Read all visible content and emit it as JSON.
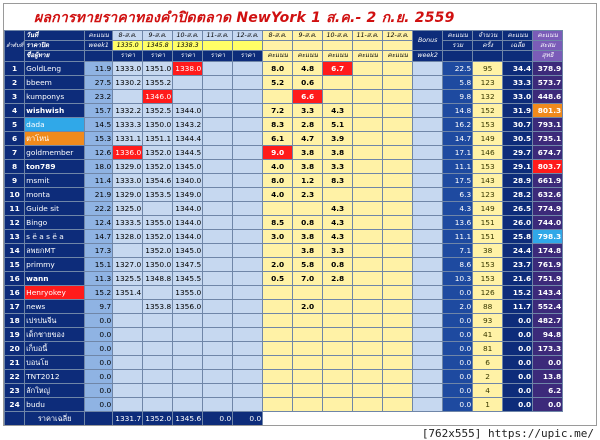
{
  "title": "ผลการทายราคาทองคำปิดตลาด NewYork 1 ส.ค.- 2 ก.ย. 2559",
  "watermark": "[762x555] https://upic.me/",
  "headers": {
    "corner_top": "วันที่",
    "corner_mid": "ราคาปิด",
    "corner_bottom": "ชื่อผู้ทาย",
    "rank_label": "ลำดับที่",
    "score_w1": "คะแนน",
    "week1": "week1",
    "date_cols": [
      "8-ส.ค.",
      "9-ส.ค.",
      "10-ส.ค.",
      "11-ส.ค.",
      "12-ส.ค."
    ],
    "close_prices": [
      "1335.0",
      "1345.8",
      "1338.3",
      "",
      ""
    ],
    "price_label": "ราคา",
    "score_cols": [
      "8-ส.ค.",
      "9-ส.ค.",
      "10-ส.ค.",
      "11-ส.ค.",
      "12-ส.ค."
    ],
    "score_label": "คะแนน",
    "bonus": "Bonus",
    "week2": "week2",
    "total_score": "คะแนน",
    "total_sub": "รวม",
    "count_label": "จำนวน",
    "count_sub": "ครั้ง",
    "avg_label": "คะแนน",
    "avg_sub": "เฉลี่ย",
    "cum_label": "คะแนน",
    "cum_sub": "สะสม",
    "cum_sub2": "สุทธิ"
  },
  "rows": [
    {
      "no": "1",
      "name": "GoldLeng",
      "w1": "11.9",
      "p": [
        "1333.0",
        "1351.0",
        "1338.0",
        "",
        ""
      ],
      "s": [
        "8.0",
        "4.8",
        "6.7",
        "",
        ""
      ],
      "bonus": "",
      "total": "22.5",
      "count": "95",
      "avg": "34.4",
      "cum": "378.9"
    },
    {
      "no": "2",
      "name": "bbeem",
      "w1": "27.5",
      "p": [
        "1330.2",
        "1355.2",
        "",
        "",
        ""
      ],
      "s": [
        "5.2",
        "0.6",
        "",
        "",
        ""
      ],
      "bonus": "",
      "total": "5.8",
      "count": "123",
      "avg": "33.3",
      "cum": "573.7"
    },
    {
      "no": "3",
      "name": "kumponys",
      "w1": "23.2",
      "p": [
        "",
        "1346.0",
        "",
        "",
        ""
      ],
      "s": [
        "",
        "6.6",
        "",
        "",
        ""
      ],
      "bonus": "",
      "total": "9.8",
      "count": "132",
      "avg": "33.0",
      "cum": "448.6"
    },
    {
      "no": "4",
      "name": "wishwish",
      "w1": "15.7",
      "p": [
        "1332.2",
        "1352.5",
        "1344.0",
        "",
        ""
      ],
      "s": [
        "7.2",
        "3.3",
        "4.3",
        "",
        ""
      ],
      "bonus": "",
      "total": "14.8",
      "count": "152",
      "avg": "31.9",
      "cum": "801.3"
    },
    {
      "no": "5",
      "name": "dada",
      "w1": "14.5",
      "p": [
        "1333.3",
        "1350.0",
        "1343.2",
        "",
        ""
      ],
      "s": [
        "8.3",
        "2.8",
        "5.1",
        "",
        ""
      ],
      "bonus": "",
      "total": "16.2",
      "count": "153",
      "avg": "30.7",
      "cum": "793.1"
    },
    {
      "no": "6",
      "name": "ตาโหน่",
      "w1": "15.3",
      "p": [
        "1331.1",
        "1351.1",
        "1344.4",
        "",
        ""
      ],
      "s": [
        "6.1",
        "4.7",
        "3.9",
        "",
        ""
      ],
      "bonus": "",
      "total": "14.7",
      "count": "149",
      "avg": "30.5",
      "cum": "735.1"
    },
    {
      "no": "7",
      "name": "goldmember",
      "w1": "12.6",
      "p": [
        "1336.0",
        "1352.0",
        "1344.5",
        "",
        ""
      ],
      "s": [
        "9.0",
        "3.8",
        "3.8",
        "",
        ""
      ],
      "bonus": "",
      "total": "17.1",
      "count": "146",
      "avg": "29.7",
      "cum": "674.7"
    },
    {
      "no": "8",
      "name": "ton789",
      "w1": "18.0",
      "p": [
        "1329.0",
        "1352.0",
        "1345.0",
        "",
        ""
      ],
      "s": [
        "4.0",
        "3.8",
        "3.3",
        "",
        ""
      ],
      "bonus": "",
      "total": "11.1",
      "count": "153",
      "avg": "29.1",
      "cum": "803.7"
    },
    {
      "no": "9",
      "name": "msmit",
      "w1": "11.4",
      "p": [
        "1333.0",
        "1354.6",
        "1340.0",
        "",
        ""
      ],
      "s": [
        "8.0",
        "1.2",
        "8.3",
        "",
        ""
      ],
      "bonus": "",
      "total": "17.5",
      "count": "143",
      "avg": "28.9",
      "cum": "661.9"
    },
    {
      "no": "10",
      "name": "monta",
      "w1": "21.9",
      "p": [
        "1329.0",
        "1353.5",
        "1349.0",
        "",
        ""
      ],
      "s": [
        "4.0",
        "2.3",
        "",
        "",
        ""
      ],
      "bonus": "",
      "total": "6.3",
      "count": "123",
      "avg": "28.2",
      "cum": "632.6"
    },
    {
      "no": "11",
      "name": "Guide sit",
      "w1": "22.2",
      "p": [
        "1325.0",
        "",
        "1344.0",
        "",
        ""
      ],
      "s": [
        "",
        "",
        "4.3",
        "",
        ""
      ],
      "bonus": "",
      "total": "4.3",
      "count": "149",
      "avg": "26.5",
      "cum": "774.9"
    },
    {
      "no": "12",
      "name": "Bingo",
      "w1": "12.4",
      "p": [
        "1333.5",
        "1355.0",
        "1344.0",
        "",
        ""
      ],
      "s": [
        "8.5",
        "0.8",
        "4.3",
        "",
        ""
      ],
      "bonus": "",
      "total": "13.6",
      "count": "151",
      "avg": "26.0",
      "cum": "744.0"
    },
    {
      "no": "13",
      "name": "s ë a s ë a",
      "w1": "14.7",
      "p": [
        "1328.0",
        "1352.0",
        "1344.0",
        "",
        ""
      ],
      "s": [
        "3.0",
        "3.8",
        "4.3",
        "",
        ""
      ],
      "bonus": "",
      "total": "11.1",
      "count": "151",
      "avg": "25.8",
      "cum": "798.3"
    },
    {
      "no": "14",
      "name": "ลพยกMT",
      "w1": "17.3",
      "p": [
        "",
        "1352.0",
        "1345.0",
        "",
        ""
      ],
      "s": [
        "",
        "3.8",
        "3.3",
        "",
        ""
      ],
      "bonus": "",
      "total": "7.1",
      "count": "38",
      "avg": "24.4",
      "cum": "174.8"
    },
    {
      "no": "15",
      "name": "primmy",
      "w1": "15.1",
      "p": [
        "1327.0",
        "1350.0",
        "1347.5",
        "",
        ""
      ],
      "s": [
        "2.0",
        "5.8",
        "0.8",
        "",
        ""
      ],
      "bonus": "",
      "total": "8.6",
      "count": "153",
      "avg": "23.7",
      "cum": "761.9"
    },
    {
      "no": "16",
      "name": "wann",
      "w1": "11.3",
      "p": [
        "1325.5",
        "1348.8",
        "1345.5",
        "",
        ""
      ],
      "s": [
        "0.5",
        "7.0",
        "2.8",
        "",
        ""
      ],
      "bonus": "",
      "total": "10.3",
      "count": "153",
      "avg": "21.6",
      "cum": "751.9"
    },
    {
      "no": "16",
      "name": "Henryokey",
      "w1": "15.2",
      "p": [
        "1351.4",
        "",
        "1355.0",
        "",
        ""
      ],
      "s": [
        "",
        "",
        "",
        "",
        ""
      ],
      "bonus": "",
      "total": "0.0",
      "count": "126",
      "avg": "15.2",
      "cum": "143.4"
    },
    {
      "no": "17",
      "name": "news",
      "w1": "9.7",
      "p": [
        "",
        "1353.8",
        "1356.0",
        "",
        ""
      ],
      "s": [
        "",
        "2.0",
        "",
        "",
        ""
      ],
      "bonus": "",
      "total": "2.0",
      "count": "88",
      "avg": "11.7",
      "cum": "552.4"
    },
    {
      "no": "18",
      "name": "เปรปนจีน",
      "w1": "0.0",
      "p": [
        "",
        "",
        "",
        "",
        ""
      ],
      "s": [
        "",
        "",
        "",
        "",
        ""
      ],
      "bonus": "",
      "total": "0.0",
      "count": "93",
      "avg": "0.0",
      "cum": "482.7"
    },
    {
      "no": "19",
      "name": "เด็กชายของ",
      "w1": "0.0",
      "p": [
        "",
        "",
        "",
        "",
        ""
      ],
      "s": [
        "",
        "",
        "",
        "",
        ""
      ],
      "bonus": "",
      "total": "0.0",
      "count": "41",
      "avg": "0.0",
      "cum": "94.8"
    },
    {
      "no": "20",
      "name": "เก็บอนี้",
      "w1": "0.0",
      "p": [
        "",
        "",
        "",
        "",
        ""
      ],
      "s": [
        "",
        "",
        "",
        "",
        ""
      ],
      "bonus": "",
      "total": "0.0",
      "count": "81",
      "avg": "0.0",
      "cum": "173.3"
    },
    {
      "no": "21",
      "name": "บอนโย",
      "w1": "0.0",
      "p": [
        "",
        "",
        "",
        "",
        ""
      ],
      "s": [
        "",
        "",
        "",
        "",
        ""
      ],
      "bonus": "",
      "total": "0.0",
      "count": "6",
      "avg": "0.0",
      "cum": "0.0"
    },
    {
      "no": "22",
      "name": "TNT2012",
      "w1": "0.0",
      "p": [
        "",
        "",
        "",
        "",
        ""
      ],
      "s": [
        "",
        "",
        "",
        "",
        ""
      ],
      "bonus": "",
      "total": "0.0",
      "count": "2",
      "avg": "0.0",
      "cum": "13.8"
    },
    {
      "no": "23",
      "name": "ลักใหญ่",
      "w1": "0.0",
      "p": [
        "",
        "",
        "",
        "",
        ""
      ],
      "s": [
        "",
        "",
        "",
        "",
        ""
      ],
      "bonus": "",
      "total": "0.0",
      "count": "4",
      "avg": "0.0",
      "cum": "6.2"
    },
    {
      "no": "24",
      "name": "budu",
      "w1": "0.0",
      "p": [
        "",
        "",
        "",
        "",
        ""
      ],
      "s": [
        "",
        "",
        "",
        "",
        ""
      ],
      "bonus": "",
      "total": "0.0",
      "count": "1",
      "avg": "0.0",
      "cum": "0.0"
    }
  ],
  "footer": {
    "label": "ราคาเฉลี่ย",
    "avgs": [
      "1331.7",
      "1352.0",
      "1345.6",
      "0.0",
      "0.0"
    ]
  },
  "colors": {
    "navy": "#0d2c7a",
    "light_blue": "#c6d8f0",
    "yellow": "#fff2a6",
    "red": "#ff1b1b",
    "orange": "#f08a1c",
    "cyan": "#30a8e8",
    "cum_header": "#7a5cb8"
  }
}
